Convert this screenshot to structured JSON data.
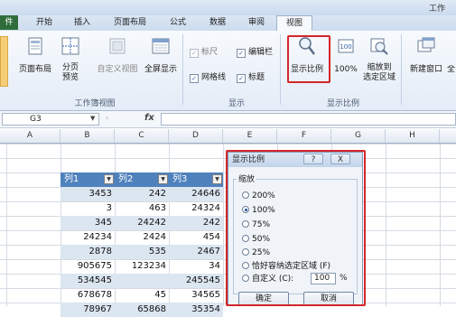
{
  "titlebar": {
    "partial_title": "工作"
  },
  "tabs": {
    "file": "件",
    "items": [
      {
        "label": "开始"
      },
      {
        "label": "插入"
      },
      {
        "label": "页面布局"
      },
      {
        "label": "公式"
      },
      {
        "label": "数据"
      },
      {
        "label": "审阅"
      },
      {
        "label": "视图"
      }
    ],
    "active": "视图"
  },
  "ribbon": {
    "workbook_views": {
      "label": "工作簿视图",
      "buttons": [
        {
          "label": "页面布局"
        },
        {
          "label": "分页\n预览"
        },
        {
          "label": "自定义视图"
        },
        {
          "label": "全屏显示"
        }
      ]
    },
    "show": {
      "label": "显示",
      "checks": [
        {
          "label": "标尺",
          "checked": true,
          "enabled": false
        },
        {
          "label": "编辑栏",
          "checked": true,
          "enabled": true
        },
        {
          "label": "网格线",
          "checked": true,
          "enabled": true
        },
        {
          "label": "标题",
          "checked": true,
          "enabled": true
        }
      ]
    },
    "zoom": {
      "label": "显示比例",
      "buttons": [
        {
          "label": "显示比例"
        },
        {
          "label": "100%"
        },
        {
          "label": "缩放到\n选定区域"
        }
      ]
    },
    "window": {
      "buttons": [
        {
          "label": "新建窗口"
        },
        {
          "label": "全"
        }
      ]
    }
  },
  "formula_bar": {
    "name_box": "G3",
    "fx": "fx",
    "value": ""
  },
  "columns": [
    "A",
    "B",
    "C",
    "D",
    "E",
    "F",
    "G",
    "H"
  ],
  "table": {
    "headers": [
      "列1",
      "列2",
      "列3"
    ],
    "rows": [
      [
        "3453",
        "242",
        "24646"
      ],
      [
        "3",
        "463",
        "24324"
      ],
      [
        "345",
        "24242",
        "242"
      ],
      [
        "24234",
        "2424",
        "454"
      ],
      [
        "2878",
        "535",
        "2467"
      ],
      [
        "905675",
        "123234",
        "34"
      ],
      [
        "534545",
        "",
        "245545"
      ],
      [
        "678678",
        "45",
        "34565"
      ],
      [
        "78967",
        "65868",
        "35354"
      ]
    ]
  },
  "dialog": {
    "title": "显示比例",
    "help": "?",
    "close": "X",
    "group_label": "缩放",
    "options": [
      {
        "label": "200%",
        "selected": false
      },
      {
        "label": "100%",
        "selected": true
      },
      {
        "label": "75%",
        "selected": false
      },
      {
        "label": "50%",
        "selected": false
      },
      {
        "label": "25%",
        "selected": false
      },
      {
        "label": "恰好容纳选定区域 (F)",
        "selected": false
      },
      {
        "label": "自定义 (C):",
        "selected": false
      }
    ],
    "custom_value": "100",
    "custom_unit": "%",
    "ok": "确定",
    "cancel": "取消"
  },
  "colors": {
    "accent": "#4f81bd",
    "band_light": "#dce6f1",
    "highlight": "#d4262b",
    "file_tab": "#2f6e3c"
  }
}
